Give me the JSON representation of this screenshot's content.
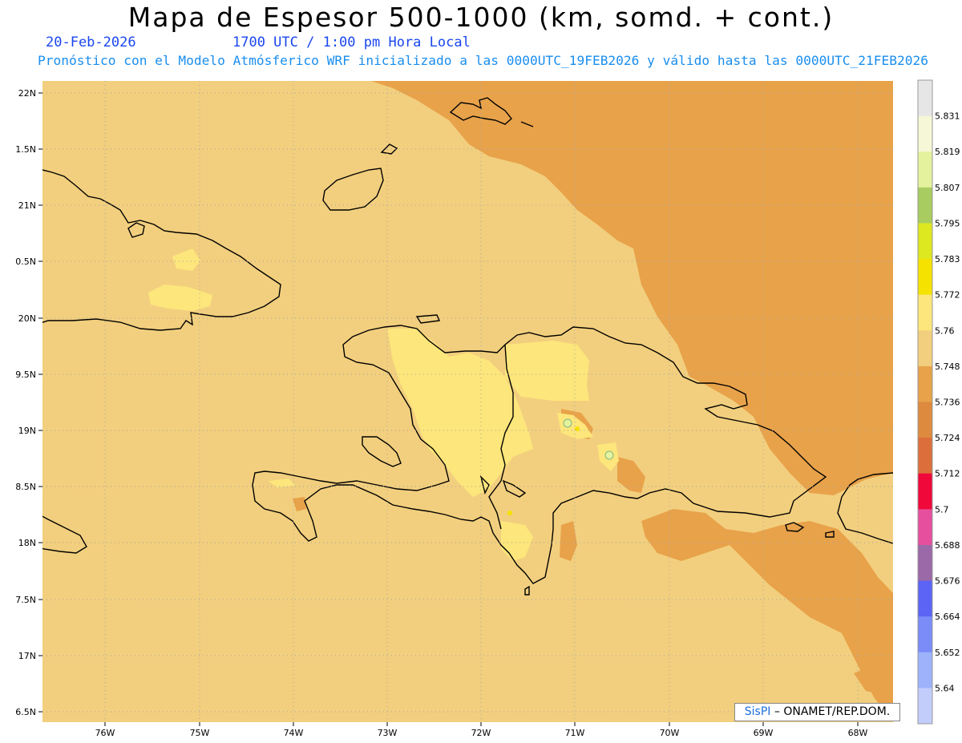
{
  "header": {
    "title": "Mapa de Espesor 500-1000 (km, somd. + cont.)",
    "date": "20-Feb-2026",
    "time": "1700 UTC / 1:00 pm Hora Local",
    "forecast": "Pronóstico con el Modelo Atmósferico WRF inicializado a las 0000UTC_19FEB2026 y válido hasta las  0000UTC_21FEB2026"
  },
  "map": {
    "lat_labels": [
      "22N",
      "1.5N",
      "21N",
      "0.5N",
      "20N",
      "9.5N",
      "19N",
      "8.5N",
      "18N",
      "7.5N",
      "17N",
      "6.5N"
    ],
    "lon_labels": [
      "76W",
      "75W",
      "74W",
      "73W",
      "72W",
      "71W",
      "70W",
      "69W",
      "68W"
    ],
    "colors": {
      "base": "#f2cf7e",
      "dark": "#e8a24a",
      "darker": "#dd8a3e",
      "light": "#fde67b",
      "coast": "#000000"
    }
  },
  "colorbar": {
    "levels": [
      "5.831",
      "5.819",
      "5.807",
      "5.795",
      "5.783",
      "5.772",
      "5.76",
      "5.748",
      "5.736",
      "5.724",
      "5.712",
      "5.7",
      "5.688",
      "5.676",
      "5.664",
      "5.652",
      "5.64"
    ],
    "colors": [
      "#e6e6e6",
      "#f5f7d6",
      "#e4f29d",
      "#a8cc60",
      "#dde820",
      "#f5e200",
      "#fde67b",
      "#f2cf7e",
      "#e8a24a",
      "#dd8a3e",
      "#dc6e3b",
      "#f0083a",
      "#e64f9d",
      "#9b68a8",
      "#5b64f5",
      "#7b8cf9",
      "#9db2fb",
      "#c2cdfc"
    ]
  },
  "credit": {
    "brand": "SisPI",
    "org": "– ONAMET/REP.DOM."
  }
}
